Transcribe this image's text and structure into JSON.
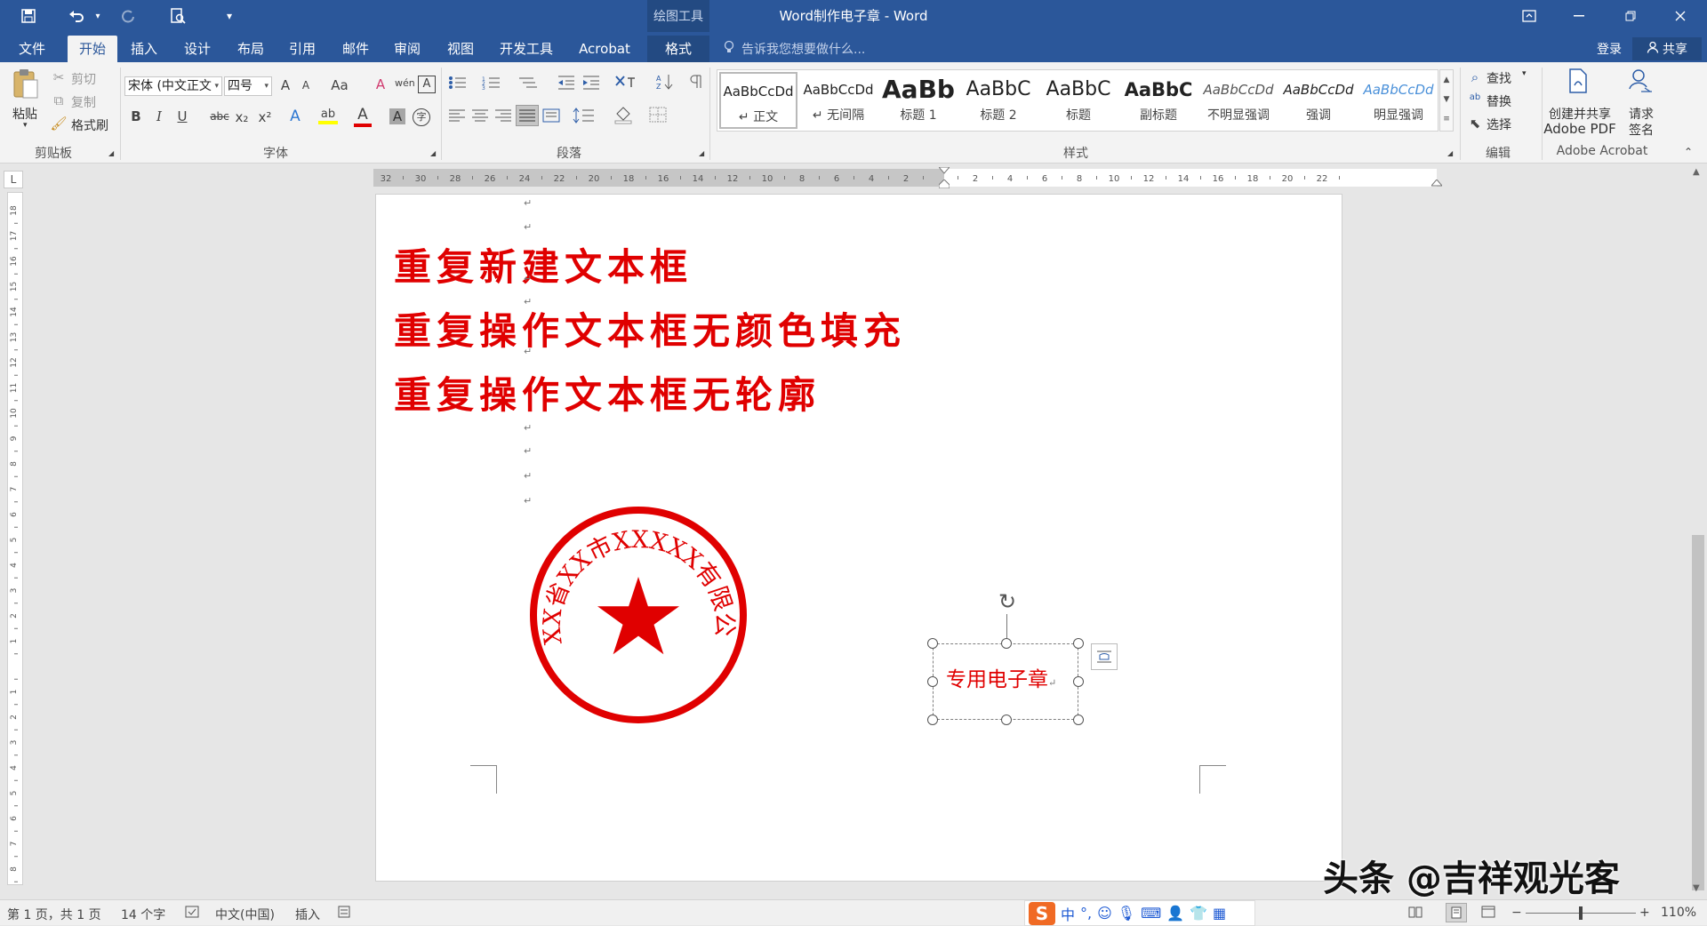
{
  "titlebar": {
    "drawing_tools": "绘图工具",
    "doc_title": "Word制作电子章 - Word",
    "save_icon": "save-icon",
    "undo_icon": "undo-icon",
    "redo_icon": "redo-icon",
    "print_preview_icon": "print-preview-icon"
  },
  "tabs": [
    {
      "label": "文件"
    },
    {
      "label": "开始"
    },
    {
      "label": "插入"
    },
    {
      "label": "设计"
    },
    {
      "label": "布局"
    },
    {
      "label": "引用"
    },
    {
      "label": "邮件"
    },
    {
      "label": "审阅"
    },
    {
      "label": "视图"
    },
    {
      "label": "开发工具"
    },
    {
      "label": "Acrobat"
    },
    {
      "label": "格式"
    }
  ],
  "tell_me": "告诉我您想要做什么...",
  "login": "登录",
  "share": "共享",
  "clipboard": {
    "paste": "粘贴",
    "cut": "剪切",
    "copy": "复制",
    "format_painter": "格式刷",
    "label": "剪贴板"
  },
  "font": {
    "font_name": "宋体 (中文正文",
    "font_size": "四号",
    "label": "字体",
    "grow": "A",
    "shrink": "A",
    "case": "Aa",
    "clear": "A",
    "phonetic": "wén",
    "border_char": "A",
    "bold": "B",
    "italic": "I",
    "underline": "U",
    "strike": "abc",
    "subscript": "x₂",
    "superscript": "x²",
    "text_effect": "A",
    "highlight": "ab",
    "font_color": "A",
    "char_shade": "A",
    "enclose": "字"
  },
  "paragraph": {
    "label": "段落"
  },
  "styles": {
    "label": "样式",
    "items": [
      {
        "preview": "AaBbCcDd",
        "name": "↵ 正文"
      },
      {
        "preview": "AaBbCcDd",
        "name": "↵ 无间隔"
      },
      {
        "preview": "AaBb",
        "name": "标题 1"
      },
      {
        "preview": "AaBbC",
        "name": "标题 2"
      },
      {
        "preview": "AaBbC",
        "name": "标题"
      },
      {
        "preview": "AaBbC",
        "name": "副标题"
      },
      {
        "preview": "AaBbCcDd",
        "name": "不明显强调"
      },
      {
        "preview": "AaBbCcDd",
        "name": "强调"
      },
      {
        "preview": "AaBbCcDd",
        "name": "明显强调"
      }
    ]
  },
  "editing": {
    "find": "查找",
    "replace": "替换",
    "select": "选择",
    "label": "编辑"
  },
  "acrobat": {
    "create_share_line1": "创建并共享",
    "create_share_line2": "Adobe PDF",
    "request_sign_line1": "请求",
    "request_sign_line2": "签名",
    "label": "Adobe Acrobat"
  },
  "ruler": {
    "corner": "L",
    "ticks": [
      "32",
      "30",
      "28",
      "26",
      "24",
      "22",
      "20",
      "18",
      "16",
      "14",
      "12",
      "10",
      "8",
      "6",
      "4",
      "2",
      "",
      "2",
      "4",
      "6",
      "8",
      "10",
      "12",
      "14",
      "16",
      "18",
      "20",
      "22"
    ],
    "vticks": [
      "18",
      "17",
      "16",
      "15",
      "14",
      "13",
      "12",
      "11",
      "10",
      "9",
      "8",
      "7",
      "6",
      "5",
      "4",
      "3",
      "2",
      "1",
      "",
      "1",
      "2",
      "3",
      "4",
      "5",
      "6",
      "7",
      "8",
      "9"
    ]
  },
  "document": {
    "lines": [
      "重复新建文本框",
      "重复操作文本框无颜色填充",
      "重复操作文本框无轮廓"
    ],
    "para_mark": "↵",
    "seal": {
      "arc_text": "XXX省XX市XXXXX有限公司",
      "color": "#e00000"
    },
    "textbox_text": "专用电子章",
    "textbox_mark": "↵"
  },
  "watermark": "头条 @吉祥观光客",
  "status": {
    "page": "第 1 页，共 1 页",
    "words": "14 个字",
    "lang": "中文(中国)",
    "mode": "插入",
    "ime_logo": "S",
    "ime_lang": "中",
    "ime_punct": "°,",
    "zoom": "110%"
  },
  "colors": {
    "accent": "#2b579a",
    "seal_red": "#e00000"
  }
}
